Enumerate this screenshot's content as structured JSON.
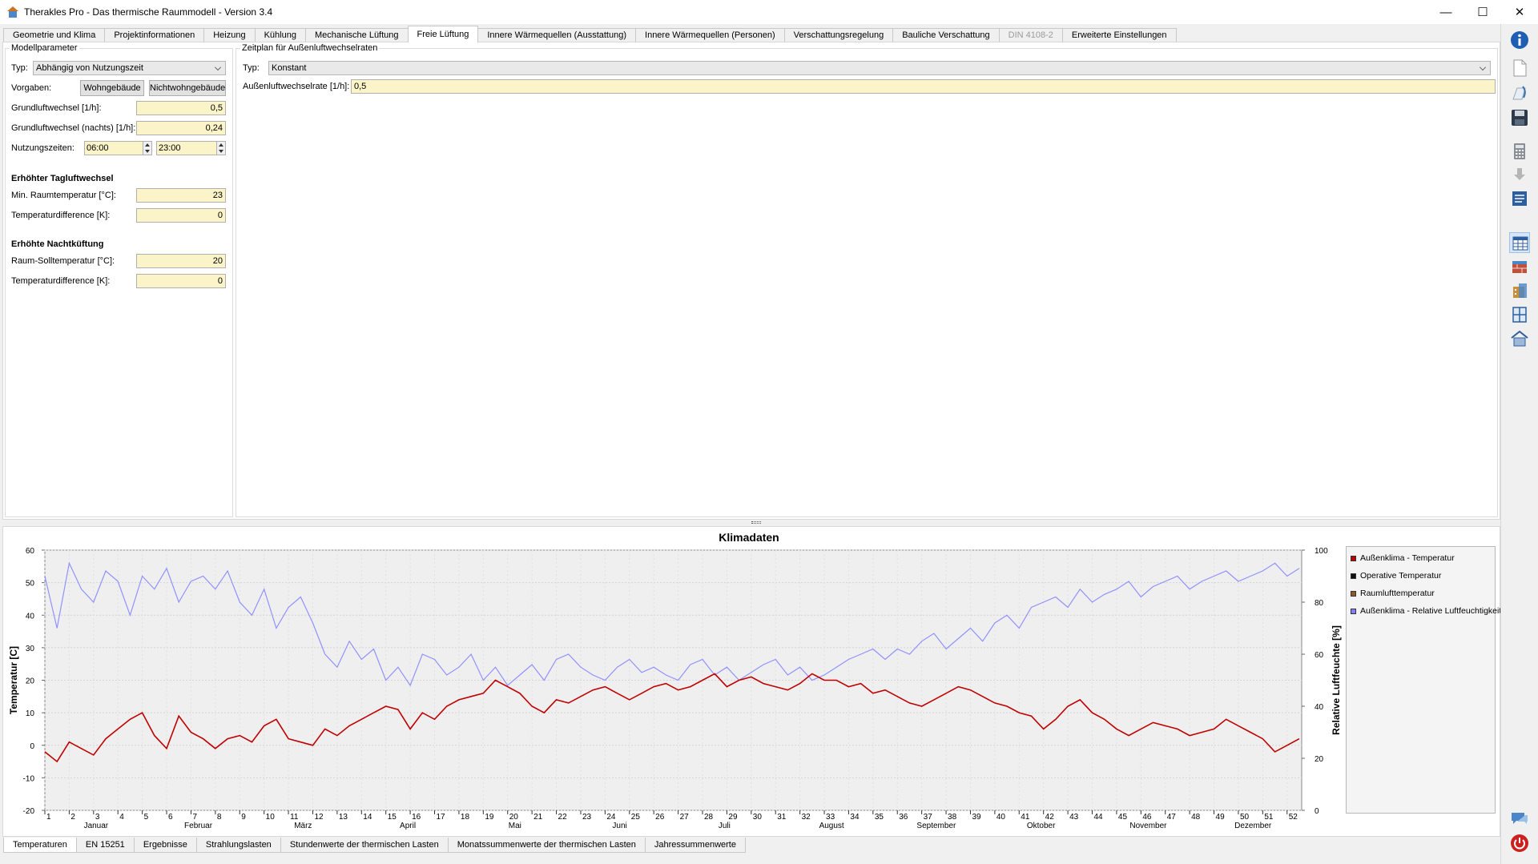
{
  "window": {
    "title": "Therakles Pro - Das thermische Raummodell - Version 3.4",
    "minimize": "—",
    "maximize": "☐",
    "close": "✕"
  },
  "tabs": [
    {
      "label": "Geometrie und Klima"
    },
    {
      "label": "Projektinformationen"
    },
    {
      "label": "Heizung"
    },
    {
      "label": "Kühlung"
    },
    {
      "label": "Mechanische Lüftung"
    },
    {
      "label": "Freie Lüftung",
      "active": true
    },
    {
      "label": "Innere Wärmequellen (Ausstattung)"
    },
    {
      "label": "Innere Wärmequellen (Personen)"
    },
    {
      "label": "Verschattungsregelung"
    },
    {
      "label": "Bauliche Verschattung"
    },
    {
      "label": "DIN 4108-2",
      "disabled": true
    },
    {
      "label": "Erweiterte Einstellungen"
    }
  ],
  "model_params": {
    "group_title": "Modellparameter",
    "type_label": "Typ:",
    "type_value": "Abhängig von Nutzungszeit",
    "presets_label": "Vorgaben:",
    "preset_residential": "Wohngebäude",
    "preset_nonresidential": "Nichtwohngebäude",
    "base_rate_label": "Grundluftwechsel [1/h]:",
    "base_rate_value": "0,5",
    "base_rate_night_label": "Grundluftwechsel (nachts) [1/h]:",
    "base_rate_night_value": "0,24",
    "usage_times_label": "Nutzungszeiten:",
    "usage_start": "06:00",
    "usage_end": "23:00",
    "day_heading": "Erhöhter Tagluftwechsel",
    "min_room_temp_label": "Min. Raumtemperatur [°C]:",
    "min_room_temp_value": "23",
    "day_temp_diff_label": "Temperaturdifference [K]:",
    "day_temp_diff_value": "0",
    "night_heading": "Erhöhte Nachtküftung",
    "room_setpoint_label": "Raum-Solltemperatur [°C]:",
    "room_setpoint_value": "20",
    "night_temp_diff_label": "Temperaturdifference [K]:",
    "night_temp_diff_value": "0"
  },
  "schedule": {
    "group_title": "Zeitplan für Außenluftwechselraten",
    "type_label": "Typ:",
    "type_value": "Konstant",
    "rate_label": "Außenluftwechselrate [1/h]:",
    "rate_value": "0,5"
  },
  "bottom_tabs": [
    {
      "label": "Temperaturen",
      "active": true
    },
    {
      "label": "EN 15251"
    },
    {
      "label": "Ergebnisse"
    },
    {
      "label": "Strahlungslasten"
    },
    {
      "label": "Stundenwerte der thermischen Lasten"
    },
    {
      "label": "Monatssummenwerte der thermischen Lasten"
    },
    {
      "label": "Jahressummenwerte"
    }
  ],
  "toolbar_icons": [
    "info-icon",
    "new-file-icon",
    "open-file-icon",
    "save-icon",
    "calculator-icon",
    "download-icon",
    "report-icon",
    "table-icon",
    "wall-icon",
    "building-icon",
    "window-icon",
    "roof-icon",
    "chat-icon",
    "power-icon"
  ],
  "chart_data": {
    "type": "line",
    "title": "Klimadaten",
    "ylabel": "Temperatur [C]",
    "ylabel_right": "Relative Luftfeuchte [%]",
    "ylim": [
      -20,
      60
    ],
    "ylim_right": [
      0,
      100
    ],
    "yticks": [
      60,
      50,
      40,
      30,
      20,
      10,
      0,
      -10,
      -20
    ],
    "yticks_right": [
      100,
      80,
      60,
      40,
      20,
      0
    ],
    "xlim": [
      1,
      52.6
    ],
    "xticks": [
      "1",
      "2",
      "3",
      "4",
      "5",
      "6",
      "7",
      "8",
      "9",
      "10",
      "11",
      "12",
      "13",
      "14",
      "15",
      "16",
      "17",
      "18",
      "19",
      "20",
      "21",
      "22",
      "23",
      "24",
      "25",
      "26",
      "27",
      "28",
      "29",
      "30",
      "31",
      "32",
      "33",
      "34",
      "35",
      "36",
      "37",
      "38",
      "39",
      "40",
      "41",
      "42",
      "43",
      "44",
      "45",
      "46",
      "47",
      "48",
      "49",
      "50",
      "51",
      "52"
    ],
    "months": [
      "Januar",
      "Februar",
      "März",
      "April",
      "Mai",
      "Juni",
      "Juli",
      "August",
      "September",
      "Oktober",
      "November",
      "Dezember"
    ],
    "month_positions": [
      3.1,
      7.3,
      11.6,
      15.9,
      20.3,
      24.6,
      28.9,
      33.3,
      37.6,
      41.9,
      46.3,
      50.6
    ],
    "grid": true,
    "legend_position": "right",
    "series": [
      {
        "name": "Außenklima - Temperatur",
        "color": "#c00000",
        "axis": "left",
        "x": [
          1,
          1.5,
          2,
          2.5,
          3,
          3.5,
          4,
          4.5,
          5,
          5.5,
          6,
          6.5,
          7,
          7.5,
          8,
          8.5,
          9,
          9.5,
          10,
          10.5,
          11,
          11.5,
          12,
          12.5,
          13,
          13.5,
          14,
          14.5,
          15,
          15.5,
          16,
          16.5,
          17,
          17.5,
          18,
          18.5,
          19,
          19.5,
          20,
          20.5,
          21,
          21.5,
          22,
          22.5,
          23,
          23.5,
          24,
          24.5,
          25,
          25.5,
          26,
          26.5,
          27,
          27.5,
          28,
          28.5,
          29,
          29.5,
          30,
          30.5,
          31,
          31.5,
          32,
          32.5,
          33,
          33.5,
          34,
          34.5,
          35,
          35.5,
          36,
          36.5,
          37,
          37.5,
          38,
          38.5,
          39,
          39.5,
          40,
          40.5,
          41,
          41.5,
          42,
          42.5,
          43,
          43.5,
          44,
          44.5,
          45,
          45.5,
          46,
          46.5,
          47,
          47.5,
          48,
          48.5,
          49,
          49.5,
          50,
          50.5,
          51,
          51.5,
          52,
          52.5
        ],
        "y": [
          -2,
          -5,
          1,
          -1,
          -3,
          2,
          5,
          8,
          10,
          3,
          -1,
          9,
          4,
          2,
          -1,
          2,
          3,
          1,
          6,
          8,
          2,
          1,
          0,
          5,
          3,
          6,
          8,
          10,
          12,
          11,
          5,
          10,
          8,
          12,
          14,
          15,
          16,
          20,
          18,
          16,
          12,
          10,
          14,
          13,
          15,
          17,
          18,
          16,
          14,
          16,
          18,
          19,
          17,
          18,
          20,
          22,
          18,
          20,
          21,
          19,
          18,
          17,
          19,
          22,
          20,
          20,
          18,
          19,
          16,
          17,
          15,
          13,
          12,
          14,
          16,
          18,
          17,
          15,
          13,
          12,
          10,
          9,
          5,
          8,
          12,
          14,
          10,
          8,
          5,
          3,
          5,
          7,
          6,
          5,
          3,
          4,
          5,
          8,
          6,
          4,
          2,
          -2,
          0,
          2
        ]
      },
      {
        "name": "Operative Temperatur",
        "color": "#111111",
        "axis": "left",
        "x": [],
        "y": []
      },
      {
        "name": "Raumlufttemperatur",
        "color": "#8b5a2b",
        "axis": "left",
        "x": [],
        "y": []
      },
      {
        "name": "Außenklima - Relative Luftfeuchtigkeit",
        "color": "#8080ff",
        "axis": "right",
        "x": [
          1,
          1.5,
          2,
          2.5,
          3,
          3.5,
          4,
          4.5,
          5,
          5.5,
          6,
          6.5,
          7,
          7.5,
          8,
          8.5,
          9,
          9.5,
          10,
          10.5,
          11,
          11.5,
          12,
          12.5,
          13,
          13.5,
          14,
          14.5,
          15,
          15.5,
          16,
          16.5,
          17,
          17.5,
          18,
          18.5,
          19,
          19.5,
          20,
          20.5,
          21,
          21.5,
          22,
          22.5,
          23,
          23.5,
          24,
          24.5,
          25,
          25.5,
          26,
          26.5,
          27,
          27.5,
          28,
          28.5,
          29,
          29.5,
          30,
          30.5,
          31,
          31.5,
          32,
          32.5,
          33,
          33.5,
          34,
          34.5,
          35,
          35.5,
          36,
          36.5,
          37,
          37.5,
          38,
          38.5,
          39,
          39.5,
          40,
          40.5,
          41,
          41.5,
          42,
          42.5,
          43,
          43.5,
          44,
          44.5,
          45,
          45.5,
          46,
          46.5,
          47,
          47.5,
          48,
          48.5,
          49,
          49.5,
          50,
          50.5,
          51,
          51.5,
          52,
          52.5
        ],
        "y": [
          90,
          70,
          95,
          85,
          80,
          92,
          88,
          75,
          90,
          85,
          93,
          80,
          88,
          90,
          85,
          92,
          80,
          75,
          85,
          70,
          78,
          82,
          72,
          60,
          55,
          65,
          58,
          62,
          50,
          55,
          48,
          60,
          58,
          52,
          55,
          60,
          50,
          55,
          48,
          52,
          56,
          50,
          58,
          60,
          55,
          52,
          50,
          55,
          58,
          53,
          55,
          52,
          50,
          56,
          58,
          52,
          55,
          50,
          53,
          56,
          58,
          52,
          55,
          50,
          52,
          55,
          58,
          60,
          62,
          58,
          62,
          60,
          65,
          68,
          62,
          66,
          70,
          65,
          72,
          75,
          70,
          78,
          80,
          82,
          78,
          85,
          80,
          83,
          85,
          88,
          82,
          86,
          88,
          90,
          85,
          88,
          90,
          92,
          88,
          90,
          92,
          95,
          90,
          93
        ]
      }
    ]
  }
}
